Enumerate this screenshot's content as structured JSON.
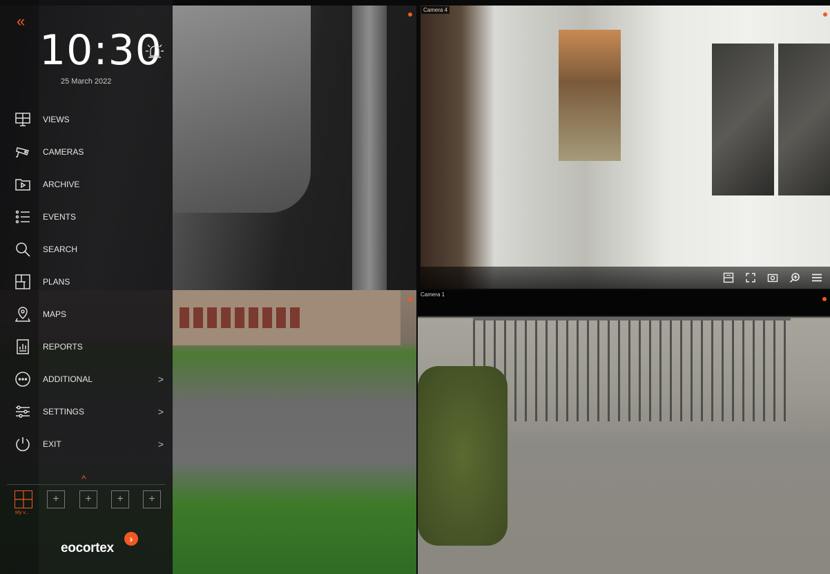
{
  "app": {
    "brand": "eocortex",
    "accent_color": "#f05a22"
  },
  "sidebar": {
    "clock": "10:30",
    "date": "25 March 2022",
    "collapse_icon": "double-chevron-left-icon",
    "alarm_icon": "alarm-siren-icon",
    "items": [
      {
        "label": "VIEWS",
        "icon": "monitor-grid-icon",
        "has_arrow": false
      },
      {
        "label": "CAMERAS",
        "icon": "camera-icon",
        "has_arrow": false
      },
      {
        "label": "ARCHIVE",
        "icon": "folder-play-icon",
        "has_arrow": false
      },
      {
        "label": "EVENTS",
        "icon": "event-list-icon",
        "has_arrow": false
      },
      {
        "label": "SEARCH",
        "icon": "search-icon",
        "has_arrow": false
      },
      {
        "label": "PLANS",
        "icon": "floor-plan-icon",
        "has_arrow": false
      },
      {
        "label": "MAPS",
        "icon": "map-pin-icon",
        "has_arrow": false
      },
      {
        "label": "REPORTS",
        "icon": "report-icon",
        "has_arrow": false
      },
      {
        "label": "ADDITIONAL",
        "icon": "more-circle-icon",
        "has_arrow": true,
        "arrow": ">"
      },
      {
        "label": "SETTINGS",
        "icon": "sliders-icon",
        "has_arrow": true,
        "arrow": ">"
      },
      {
        "label": "EXIT",
        "icon": "power-icon",
        "has_arrow": true,
        "arrow": ">"
      }
    ],
    "layouts": {
      "expand_icon": "^",
      "active_caption": "My v...",
      "add_slot_label": "+"
    }
  },
  "cameras": [
    {
      "label": "Camera 4",
      "recording": true
    },
    {
      "label": "Camera 1",
      "recording": true
    }
  ],
  "video_controls": [
    "layout-icon",
    "fullscreen-icon",
    "snapshot-icon",
    "zoom-icon",
    "menu-icon"
  ]
}
